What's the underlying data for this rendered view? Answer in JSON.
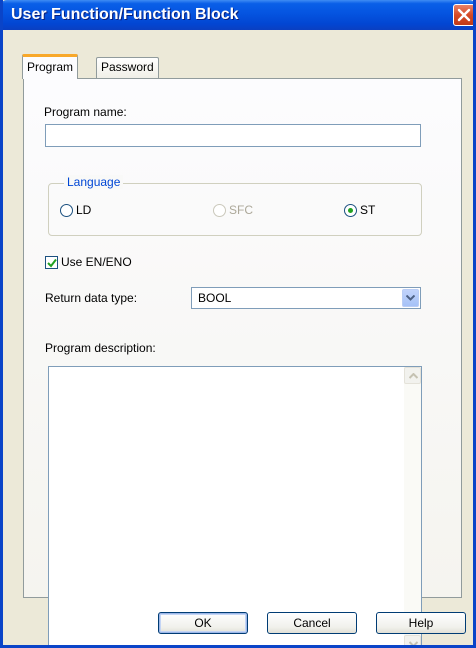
{
  "window": {
    "title": "User Function/Function Block"
  },
  "tabs": [
    {
      "label": "Program",
      "active": true
    },
    {
      "label": "Password",
      "active": false
    }
  ],
  "form": {
    "program_name_label": "Program name:",
    "program_name_value": "",
    "language": {
      "legend": "Language",
      "options": [
        {
          "label": "LD",
          "selected": false,
          "enabled": true
        },
        {
          "label": "SFC",
          "selected": false,
          "enabled": false
        },
        {
          "label": "ST",
          "selected": true,
          "enabled": true
        }
      ]
    },
    "use_en_eno": {
      "label": "Use EN/ENO",
      "checked": true
    },
    "return_type": {
      "label": "Return data type:",
      "value": "BOOL"
    },
    "description": {
      "label": "Program description:",
      "value": ""
    }
  },
  "buttons": {
    "ok": "OK",
    "cancel": "Cancel",
    "help": "Help"
  },
  "colors": {
    "titlebar": "#0554e0",
    "group_legend": "#0046d5",
    "active_tab_accent": "#f8a82a",
    "radio_dot": "#21a121"
  }
}
